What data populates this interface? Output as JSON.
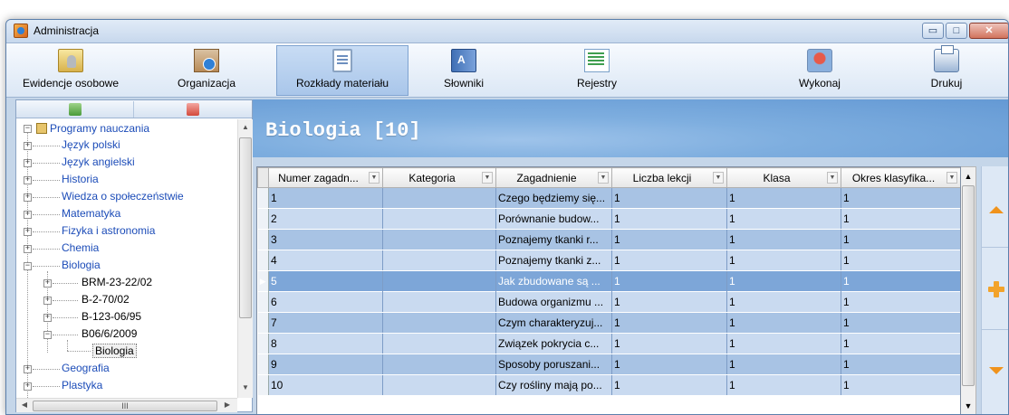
{
  "window": {
    "title": "Administracja",
    "buttons": {
      "minimize": "▭",
      "maximize": "□",
      "close": "✕"
    }
  },
  "toolbar": {
    "items": [
      {
        "label": "Ewidencje osobowe",
        "icon": "person-folder-icon"
      },
      {
        "label": "Organizacja",
        "icon": "school-building-icon"
      },
      {
        "label": "Rozkłady materiału",
        "icon": "clipboard-icon",
        "active": true
      },
      {
        "label": "Słowniki",
        "icon": "dictionary-book-icon"
      },
      {
        "label": "Rejestry",
        "icon": "register-list-icon"
      },
      {
        "label": "Wykonaj",
        "icon": "stamp-icon"
      },
      {
        "label": "Drukuj",
        "icon": "printer-icon"
      }
    ]
  },
  "tree": {
    "root": "Programy nauczania",
    "items": [
      "Język polski",
      "Język angielski",
      "Historia",
      "Wiedza o społeczeństwie",
      "Matematyka",
      "Fizyka i astronomia",
      "Chemia",
      "Biologia",
      "Geografia",
      "Plastyka"
    ],
    "biologia_children": [
      "BRM-23-22/02",
      "B-2-70/02",
      "B-123-06/95",
      "B06/6/2009"
    ],
    "leaf": "Biologia"
  },
  "header": {
    "title": "Biologia [10]"
  },
  "grid": {
    "columns": [
      "Numer zagadn...",
      "Kategoria",
      "Zagadnienie",
      "Liczba lekcji",
      "Klasa",
      "Okres klasyfika..."
    ],
    "selected_row": 4,
    "rows": [
      {
        "num": "1",
        "kategoria": "",
        "zagadnienie": "Czego będziemy się...",
        "lekcje": "1",
        "klasa": "1",
        "okres": "1"
      },
      {
        "num": "2",
        "kategoria": "",
        "zagadnienie": "Porównanie budow...",
        "lekcje": "1",
        "klasa": "1",
        "okres": "1"
      },
      {
        "num": "3",
        "kategoria": "",
        "zagadnienie": "Poznajemy tkanki r...",
        "lekcje": "1",
        "klasa": "1",
        "okres": "1"
      },
      {
        "num": "4",
        "kategoria": "",
        "zagadnienie": "Poznajemy tkanki z...",
        "lekcje": "1",
        "klasa": "1",
        "okres": "1"
      },
      {
        "num": "5",
        "kategoria": "",
        "zagadnienie": "Jak zbudowane są ...",
        "lekcje": "1",
        "klasa": "1",
        "okres": "1"
      },
      {
        "num": "6",
        "kategoria": "",
        "zagadnienie": "Budowa organizmu ...",
        "lekcje": "1",
        "klasa": "1",
        "okres": "1"
      },
      {
        "num": "7",
        "kategoria": "",
        "zagadnienie": "Czym charakteryzuj...",
        "lekcje": "1",
        "klasa": "1",
        "okres": "1"
      },
      {
        "num": "8",
        "kategoria": "",
        "zagadnienie": "Związek pokrycia c...",
        "lekcje": "1",
        "klasa": "1",
        "okres": "1"
      },
      {
        "num": "9",
        "kategoria": "",
        "zagadnienie": "Sposoby poruszani...",
        "lekcje": "1",
        "klasa": "1",
        "okres": "1"
      },
      {
        "num": "10",
        "kategoria": "",
        "zagadnienie": "Czy rośliny mają po...",
        "lekcje": "1",
        "klasa": "1",
        "okres": "1"
      }
    ]
  },
  "icons": {
    "move_up": "arrow-up-icon",
    "add": "plus-icon",
    "move_down": "arrow-down-icon"
  },
  "colors": {
    "accent": "#f0931c",
    "header_blue": "#7eaedf",
    "row_odd": "#a8c3e4",
    "row_even": "#c9daf0"
  }
}
